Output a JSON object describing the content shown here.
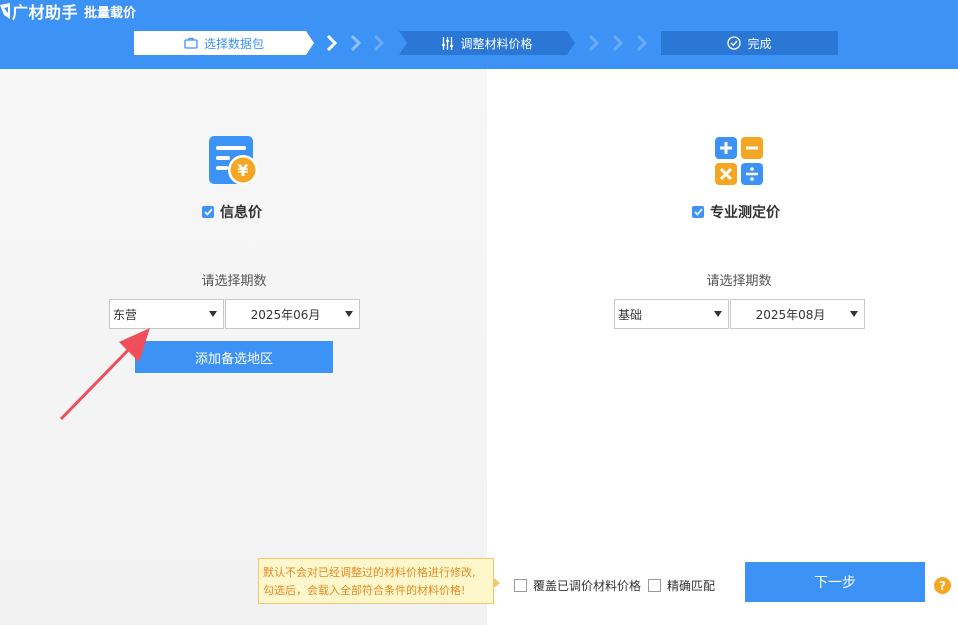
{
  "app": {
    "name": "广材助手",
    "module": "批量载价"
  },
  "steps": [
    {
      "label": "选择数据包",
      "icon": "briefcase-icon",
      "state": "active"
    },
    {
      "label": "调整材料价格",
      "icon": "sliders-icon",
      "state": "pending"
    },
    {
      "label": "完成",
      "icon": "check-circle-icon",
      "state": "pending"
    }
  ],
  "left": {
    "option_label": "信息价",
    "option_checked": true,
    "period_label": "请选择期数",
    "region_value": "东营",
    "period_value": "2025年06月",
    "add_region_label": "添加备选地区"
  },
  "right": {
    "option_label": "专业测定价",
    "option_checked": true,
    "period_label": "请选择期数",
    "type_value": "基础",
    "period_value": "2025年08月"
  },
  "footer": {
    "tooltip_line1": "默认不会对已经调整过的材料价格进行修改,",
    "tooltip_line2": "勾选后，会载入全部符合条件的材料价格!",
    "overwrite_label": "覆盖已调价材料价格",
    "overwrite_checked": false,
    "exact_match_label": "精确匹配",
    "exact_match_checked": false,
    "next_label": "下一步",
    "help_symbol": "?"
  },
  "colors": {
    "primary": "#3d93f5",
    "step_dark": "#2a77d6",
    "accent_orange": "#f5a623",
    "annotation_red": "#ef4e5a"
  }
}
